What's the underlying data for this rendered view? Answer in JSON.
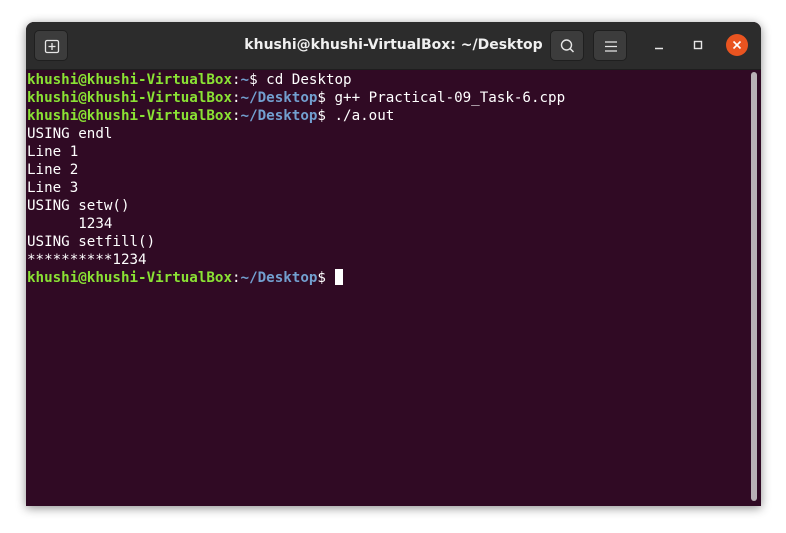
{
  "window": {
    "title": "khushi@khushi-VirtualBox: ~/Desktop"
  },
  "icons": {
    "new_tab": "new-tab-icon",
    "search": "search-icon",
    "menu": "hamburger-menu-icon",
    "minimize": "minimize-icon",
    "maximize": "maximize-icon",
    "close": "close-icon"
  },
  "colors": {
    "terminal_bg": "#300a24",
    "prompt_user": "#8ae234",
    "prompt_path": "#729fcf",
    "close_button": "#e95420"
  },
  "terminal": {
    "lines": [
      {
        "user": "khushi@khushi-VirtualBox",
        "sep": ":",
        "path": "~",
        "tail": "$ cd Desktop"
      },
      {
        "user": "khushi@khushi-VirtualBox",
        "sep": ":",
        "path": "~/Desktop",
        "tail": "$ g++ Practical-09_Task-6.cpp"
      },
      {
        "user": "khushi@khushi-VirtualBox",
        "sep": ":",
        "path": "~/Desktop",
        "tail": "$ ./a.out"
      },
      {
        "text": "USING endl"
      },
      {
        "text": "Line 1"
      },
      {
        "text": "Line 2"
      },
      {
        "text": "Line 3"
      },
      {
        "text": "USING setw()"
      },
      {
        "text": "      1234"
      },
      {
        "text": "USING setfill()"
      },
      {
        "text": "**********1234"
      },
      {
        "user": "khushi@khushi-VirtualBox",
        "sep": ":",
        "path": "~/Desktop",
        "tail": "$"
      }
    ]
  }
}
